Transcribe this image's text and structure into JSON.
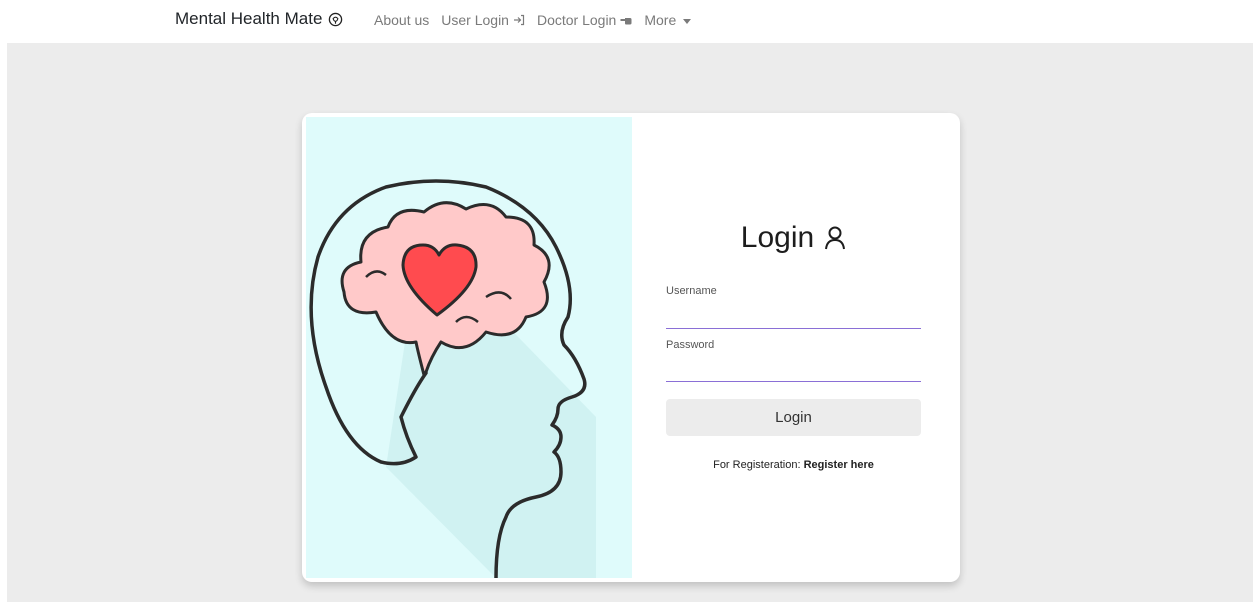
{
  "nav": {
    "brand": "Mental Health Mate",
    "links": [
      {
        "label": "About us"
      },
      {
        "label": "User Login"
      },
      {
        "label": "Doctor Login"
      },
      {
        "label": "More"
      }
    ]
  },
  "login": {
    "title": "Login",
    "username_label": "Username",
    "username_value": "",
    "password_label": "Password",
    "password_value": "",
    "button_label": "Login",
    "register_prefix": "For Registeration:",
    "register_link": "Register here"
  },
  "colors": {
    "illustration_bg": "#dffbfb",
    "brain": "#ffc9c9",
    "heart": "#ff4b4f",
    "input_underline": "#8a6fd6"
  },
  "icons": {
    "brand": "brain-head-icon",
    "user_login": "sign-in-icon",
    "doctor_login": "hand-pointing-icon",
    "more": "caret-down-icon",
    "login_title": "user-icon"
  }
}
